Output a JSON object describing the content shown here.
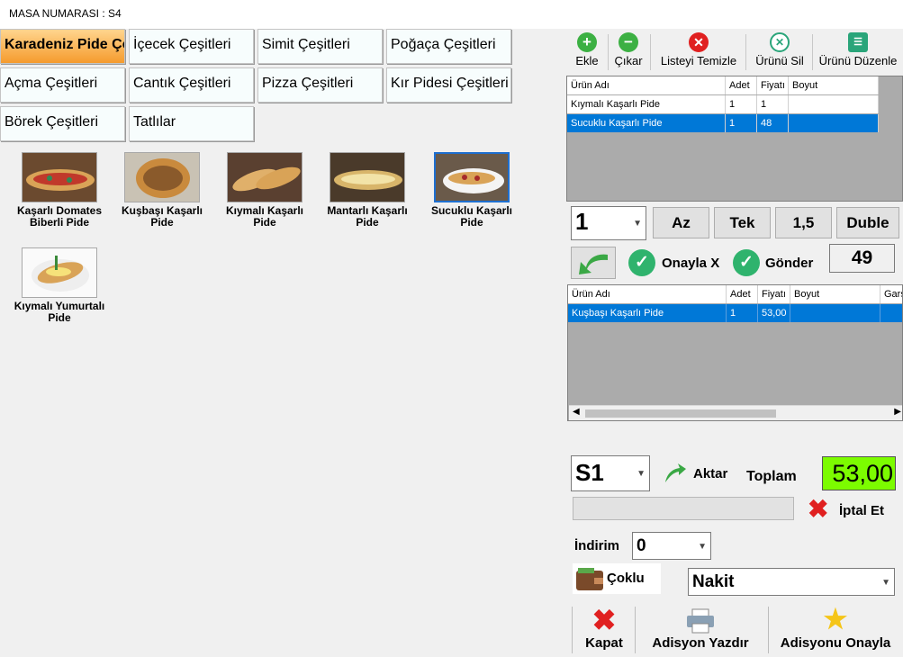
{
  "header": {
    "table_label": "MASA NUMARASI : S4"
  },
  "categories": [
    {
      "label": "Karadeniz Pide Çeşitleri"
    },
    {
      "label": "İçecek Çeşitleri"
    },
    {
      "label": "Simit Çeşitleri"
    },
    {
      "label": "Poğaça Çeşitleri"
    },
    {
      "label": "Açma Çeşitleri"
    },
    {
      "label": "Cantık Çeşitleri"
    },
    {
      "label": "Pizza Çeşitleri"
    },
    {
      "label": "Kır Pidesi Çeşitleri"
    },
    {
      "label": "Börek Çeşitleri"
    },
    {
      "label": "Tatlılar"
    }
  ],
  "products": [
    {
      "name": "Kaşarlı Domates Biberli Pide"
    },
    {
      "name": "Kuşbaşı Kaşarlı Pide"
    },
    {
      "name": "Kıymalı Kaşarlı Pide"
    },
    {
      "name": "Mantarlı Kaşarlı Pide"
    },
    {
      "name": "Sucuklu Kaşarlı Pide"
    },
    {
      "name": "Kıymalı Yumurtalı Pide"
    }
  ],
  "toolbar": {
    "add": "Ekle",
    "remove": "Çıkar",
    "clear": "Listeyi Temizle",
    "delete": "Ürünü Sil",
    "edit": "Ürünü Düzenle"
  },
  "order_grid": {
    "headers": [
      "Ürün Adı",
      "Adet",
      "Fiyatı",
      "Boyut"
    ],
    "rows": [
      [
        "Kıymalı Kaşarlı Pide",
        "1",
        "1",
        ""
      ],
      [
        "Sucuklu Kaşarlı Pide",
        "1",
        "48",
        ""
      ]
    ]
  },
  "portion": {
    "quantity": "1",
    "options": [
      "Az",
      "Tek",
      "1,5",
      "Duble"
    ]
  },
  "actions": {
    "confirm_x": "Onayla X",
    "send": "Gönder",
    "counter": "49"
  },
  "sent_grid": {
    "headers": [
      "Ürün Adı",
      "Adet",
      "Fiyatı",
      "Boyut",
      "Gars"
    ],
    "rows": [
      [
        "Kuşbaşı Kaşarlı Pide",
        "1",
        "53,00",
        "",
        ""
      ]
    ]
  },
  "payment": {
    "table_select": "S1",
    "transfer": "Aktar",
    "total_label": "Toplam",
    "total_value": "53,00",
    "cancel": "İptal Et",
    "discount_label": "İndirim",
    "discount_value": "0",
    "multi": "Çoklu",
    "method": "Nakit",
    "close": "Kapat",
    "print": "Adisyon Yazdır",
    "approve": "Adisyonu Onayla"
  },
  "colors": {
    "selection": "#0078d7",
    "total_bg": "#7cfc00",
    "active_category": "#f59b2d"
  }
}
